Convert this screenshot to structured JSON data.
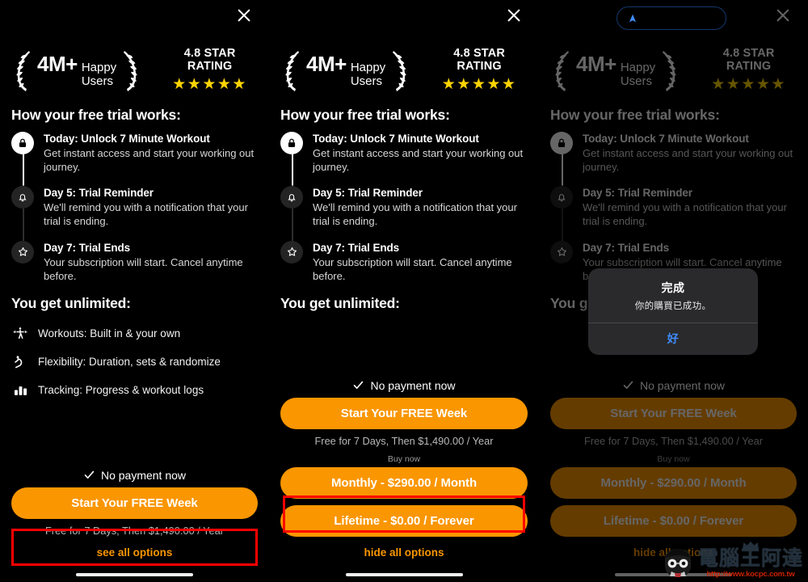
{
  "top_pill": {
    "icon": "location-arrow-icon",
    "accent": "#3F8CFF",
    "border": "#12386e"
  },
  "theme": {
    "orange": "#FA9600",
    "star": "#FFD400",
    "link": "#FA9600",
    "highlight": "#FF0000",
    "alert_button": "#3F8CFF"
  },
  "paywall": {
    "close_label": "×",
    "badges": {
      "users_number": "4M+",
      "users_label_line1": "Happy",
      "users_label_line2": "Users",
      "rating_label": "4.8 STAR RATING",
      "stars": "★★★★★"
    },
    "trial_heading": "How your free trial works:",
    "timeline": [
      {
        "icon": "lock-icon",
        "title": "Today: Unlock 7 Minute Workout",
        "desc": "Get instant access and start your working out journey."
      },
      {
        "icon": "bell-icon",
        "title": "Day 5: Trial Reminder",
        "desc": "We'll remind you with a notification that your trial is ending."
      },
      {
        "icon": "star-icon",
        "title": "Day 7: Trial Ends",
        "desc": "Your subscription will start. Cancel anytime before."
      }
    ],
    "unlimited_heading": "You get unlimited:",
    "features": [
      {
        "icon": "workout-figure-icon",
        "text": "Workouts: Built in & your own"
      },
      {
        "icon": "stretching-figure-icon",
        "text": "Flexibility: Duration, sets & randomize"
      },
      {
        "icon": "bar-chart-icon",
        "text": "Tracking: Progress & workout logs"
      }
    ],
    "cta": {
      "no_payment": "No payment now",
      "primary_button": "Start Your FREE Week",
      "price_note": "Free for 7 Days, Then $1,490.00 / Year",
      "see_all_options": "see all options",
      "hide_all_options": "hide all options",
      "buy_now_label": "Buy now",
      "options": [
        {
          "label": "Monthly - $290.00 / Month"
        },
        {
          "label": "Lifetime - $0.00 / Forever"
        }
      ]
    }
  },
  "alert": {
    "title": "完成",
    "message": "你的購買已成功。",
    "button": "好"
  },
  "watermark": {
    "text": "電腦王阿達",
    "url": "http://www.kocpc.com.tw"
  }
}
